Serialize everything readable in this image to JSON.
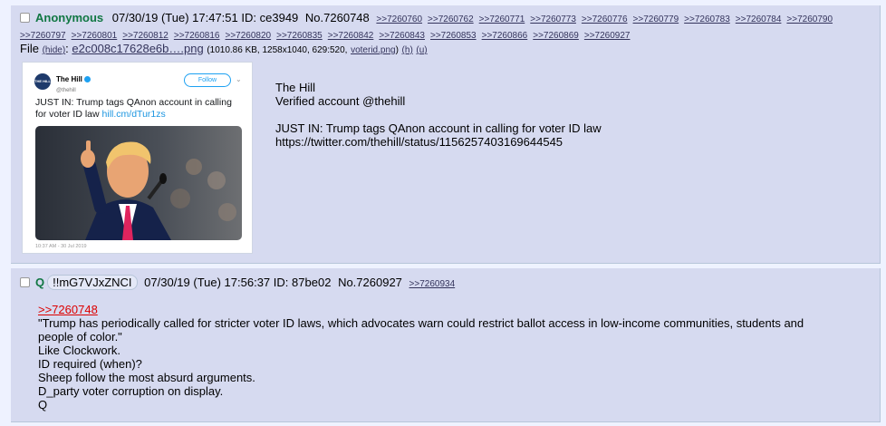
{
  "post1": {
    "name": "Anonymous",
    "datetime": "07/30/19 (Tue) 17:47:51",
    "id_label": "ID:",
    "id": "ce3949",
    "no_label": "No.",
    "no": "7260748",
    "replies": [
      ">>7260760",
      ">>7260762",
      ">>7260771",
      ">>7260773",
      ">>7260776",
      ">>7260779",
      ">>7260783",
      ">>7260784",
      ">>7260790",
      ">>7260797",
      ">>7260801",
      ">>7260812",
      ">>7260816",
      ">>7260820",
      ">>7260835",
      ">>7260842",
      ">>7260843",
      ">>7260853",
      ">>7260866",
      ">>7260869",
      ">>7260927"
    ],
    "file_label": "File",
    "file_hide": "(hide)",
    "file_name": "e2c008c17628e6b….png",
    "file_info": "(1010.86 KB, 1258x1040, 629:520,",
    "file_voterid": "voterid.png",
    "file_h": "(h)",
    "file_u": "(u)",
    "thumbnail": {
      "account": "The Hill",
      "handle": "@thehill",
      "follow": "Follow",
      "logo": "THE HILL",
      "tweet_text": "JUST IN: Trump tags QAnon account in calling for voter ID law",
      "tweet_link": "hill.cm/dTur1zs",
      "timestamp": "10:37 AM - 30 Jul 2019"
    },
    "body": [
      "The Hill",
      "Verified account @thehill",
      "",
      "JUST IN: Trump tags QAnon account in calling for voter ID law",
      "https://twitter.com/thehill/status/1156257403169644545"
    ]
  },
  "post2": {
    "name": "Q",
    "tripcode": "!!mG7VJxZNCI",
    "datetime": "07/30/19 (Tue) 17:56:37",
    "id_label": "ID:",
    "id": "87be02",
    "no_label": "No.",
    "no": "7260927",
    "replies": [
      ">>7260934"
    ],
    "quote_link": ">>7260748",
    "body": [
      "\"Trump has periodically called for stricter voter ID laws, which advocates warn could restrict ballot access in low-income communities, students and",
      "people of color.\"",
      "Like Clockwork.",
      "ID required (when)?",
      "Sheep follow the most absurd arguments.",
      "D_party voter corruption on display.",
      "Q"
    ]
  },
  "colors": {
    "page_bg": "#eef2ff",
    "post_bg": "#d6daf0",
    "name": "#117743",
    "link": "#34345c",
    "quote_link": "#dd0000",
    "twitter_blue": "#1da1f2"
  }
}
